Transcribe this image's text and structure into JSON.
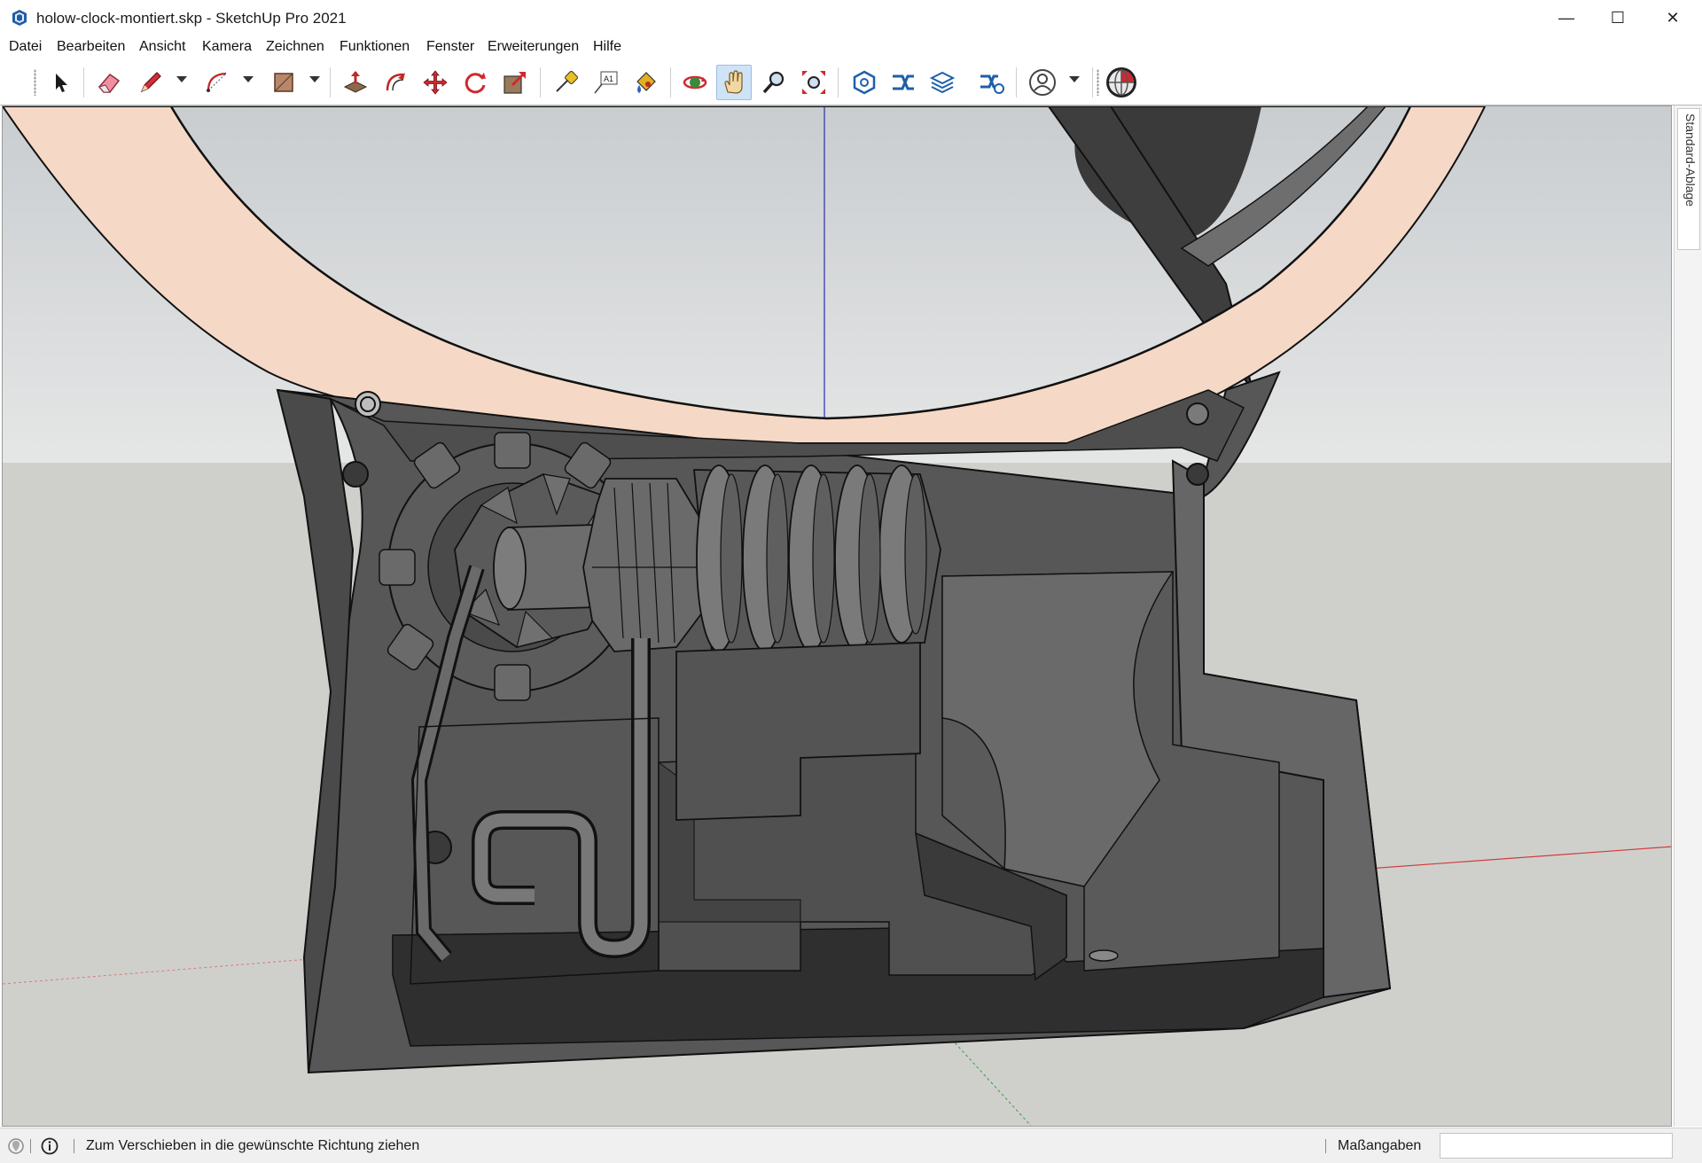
{
  "window": {
    "title": "holow-clock-montiert.skp - SketchUp Pro 2021",
    "minimize_glyph": "—",
    "maximize_glyph": "☐",
    "close_glyph": "✕"
  },
  "menu": {
    "items": [
      {
        "label": "Datei"
      },
      {
        "label": "Bearbeiten"
      },
      {
        "label": "Ansicht"
      },
      {
        "label": "Kamera"
      },
      {
        "label": "Zeichnen"
      },
      {
        "label": "Funktionen"
      },
      {
        "label": "Fenster"
      },
      {
        "label": "Erweiterungen"
      },
      {
        "label": "Hilfe"
      }
    ]
  },
  "toolbar": {
    "tools": [
      {
        "icon": "select-arrow-icon"
      },
      {
        "icon": "eraser-icon"
      },
      {
        "icon": "pencil-icon"
      },
      {
        "icon": "arc-icon"
      },
      {
        "icon": "rectangle-icon"
      },
      {
        "icon": "push-pull-icon"
      },
      {
        "icon": "offset-icon"
      },
      {
        "icon": "move-icon"
      },
      {
        "icon": "rotate-icon"
      },
      {
        "icon": "scale-icon"
      },
      {
        "icon": "tape-measure-icon"
      },
      {
        "icon": "text-label-icon"
      },
      {
        "icon": "paint-bucket-icon"
      },
      {
        "icon": "orbit-icon"
      },
      {
        "icon": "pan-hand-icon",
        "active": true
      },
      {
        "icon": "zoom-icon"
      },
      {
        "icon": "zoom-extents-icon"
      },
      {
        "icon": "warehouse-icon"
      },
      {
        "icon": "extension-warehouse-icon"
      },
      {
        "icon": "layout-send-icon"
      },
      {
        "icon": "extension-manager-icon"
      },
      {
        "icon": "account-icon"
      },
      {
        "icon": "trimble-connect-icon"
      }
    ],
    "text_tool_glyph": "A1"
  },
  "tray": {
    "tab_label": "Standard-Ablage"
  },
  "status": {
    "hint": "Zum Verschieben in die gewünschte Richtung ziehen",
    "measurements_label": "Maßangaben",
    "measurements_value": ""
  },
  "colors": {
    "sky": "#d9dcdd",
    "ground": "#cfd0cc",
    "clock_ring": "#f5d8c6",
    "housing": "#5d5d5d",
    "housing_dark": "#3a3a3a",
    "axis_blue": "#2b2bb0",
    "axis_red": "#d23c3c",
    "axis_green": "#3c9a3c",
    "active_tool": "#cfe3f6"
  }
}
